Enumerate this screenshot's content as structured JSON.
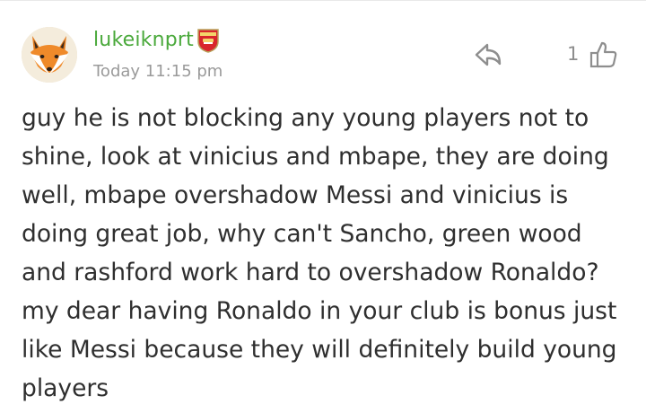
{
  "comment": {
    "username": "lukeiknprt",
    "timestamp": "Today 11:15 pm",
    "like_count": "1",
    "text": "guy he is not blocking any young players not to shine, look at vinicius and mbape, they are doing well, mbape overshadow Messi and vinicius is doing great job, why can't Sancho, green wood and rashford work hard to overshadow Ronaldo? my dear having Ronaldo in your club is bonus just like Messi because they will definitely build young players",
    "avatar_icon": "fox-avatar",
    "badge_icon": "arsenal-crest-icon",
    "reply_icon": "reply-arrow-icon",
    "like_icon": "thumbs-up-icon"
  },
  "colors": {
    "username": "#4aa93b",
    "timestamp": "#9a9a9a",
    "text": "#2f2f2f",
    "icons": "#8e8e8e"
  }
}
